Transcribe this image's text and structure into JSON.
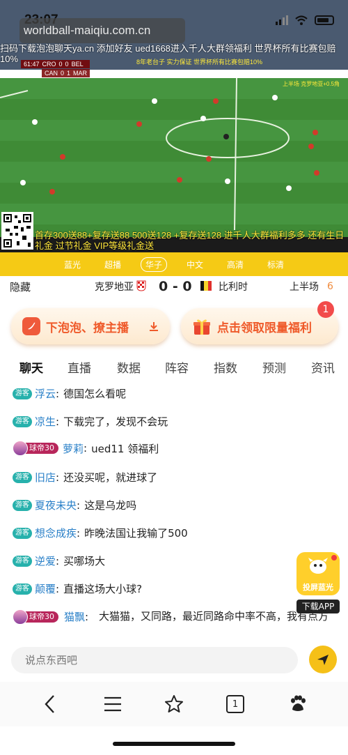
{
  "status_bar": {
    "time": "23:07"
  },
  "browser": {
    "url": "worldball-maiqiu.com.cn"
  },
  "video": {
    "promo_top": "扫码下载泡泡聊天ya.cn 添加好友 ued1668进入千人大群领福利 世界杯所有比赛包赔10%",
    "scoreboard": {
      "clock": "61:47",
      "team_a_code": "CRO",
      "team_a_score": "0",
      "team_b_code": "BEL",
      "team_b_score": "0",
      "team_c_code": "CAN",
      "team_c_score": "0",
      "team_d_code": "MAR",
      "team_d_score": "1"
    },
    "overlay_yellow": "8年老台子 实力保证 世界杯所有比赛包赔10%",
    "overlay_right": "上半场 克罗地亚+0.5角",
    "promo_bottom": "首存300送88+复存送88 500送128 +复存送128 进千人大群福利多多 还有生日礼金 过节礼金 VIP等级礼金送"
  },
  "quality": {
    "options": [
      "蓝光",
      "超播",
      "华子",
      "中文",
      "高清",
      "标清"
    ],
    "selected": "华子"
  },
  "match": {
    "hide_label": "隐藏",
    "team_a": "克罗地亚",
    "score": "0 - 0",
    "team_b": "比利时",
    "period": "上半场",
    "period_num": "6"
  },
  "actions": {
    "left_label": "下泡泡、撩主播",
    "right_label": "点击领取限量福利",
    "right_badge": "1"
  },
  "tabs": [
    "聊天",
    "直播",
    "数据",
    "阵容",
    "指数",
    "预测",
    "资讯"
  ],
  "active_tab": "聊天",
  "chat": {
    "guest_tag": "游客",
    "vip_tag": "球帝30",
    "messages": [
      {
        "type": "guest",
        "user": "浮云",
        "text": "德国怎么看呢"
      },
      {
        "type": "guest",
        "user": "凉生",
        "text": "下载完了，发现不会玩"
      },
      {
        "type": "vip",
        "user": "萝莉",
        "text": "ued11 领福利"
      },
      {
        "type": "guest",
        "user": "旧店",
        "text": "还没买呢，就进球了"
      },
      {
        "type": "guest",
        "user": "夏夜未央",
        "text": "这是乌龙吗"
      },
      {
        "type": "guest",
        "user": "想念成疾",
        "text": "昨晚法国让我输了500"
      },
      {
        "type": "guest",
        "user": "逆爱",
        "text": "买哪场大"
      },
      {
        "type": "guest",
        "user": "颠覆",
        "text": "直播这场大小球?"
      },
      {
        "type": "vip",
        "user": "猫飘",
        "text": "大猫猫，又同路，最近同路命中率不高，我有点方"
      }
    ]
  },
  "float_app": {
    "caption": "投屏蓝光",
    "download": "下载APP"
  },
  "input": {
    "placeholder": "说点东西吧"
  },
  "browser_nav": {
    "tab_count": "1"
  },
  "colors": {
    "accent_yellow": "#f5ca15",
    "username_blue": "#2a80c8",
    "guest_teal": "#27b1ac",
    "action_orange": "#ef5a2a"
  }
}
